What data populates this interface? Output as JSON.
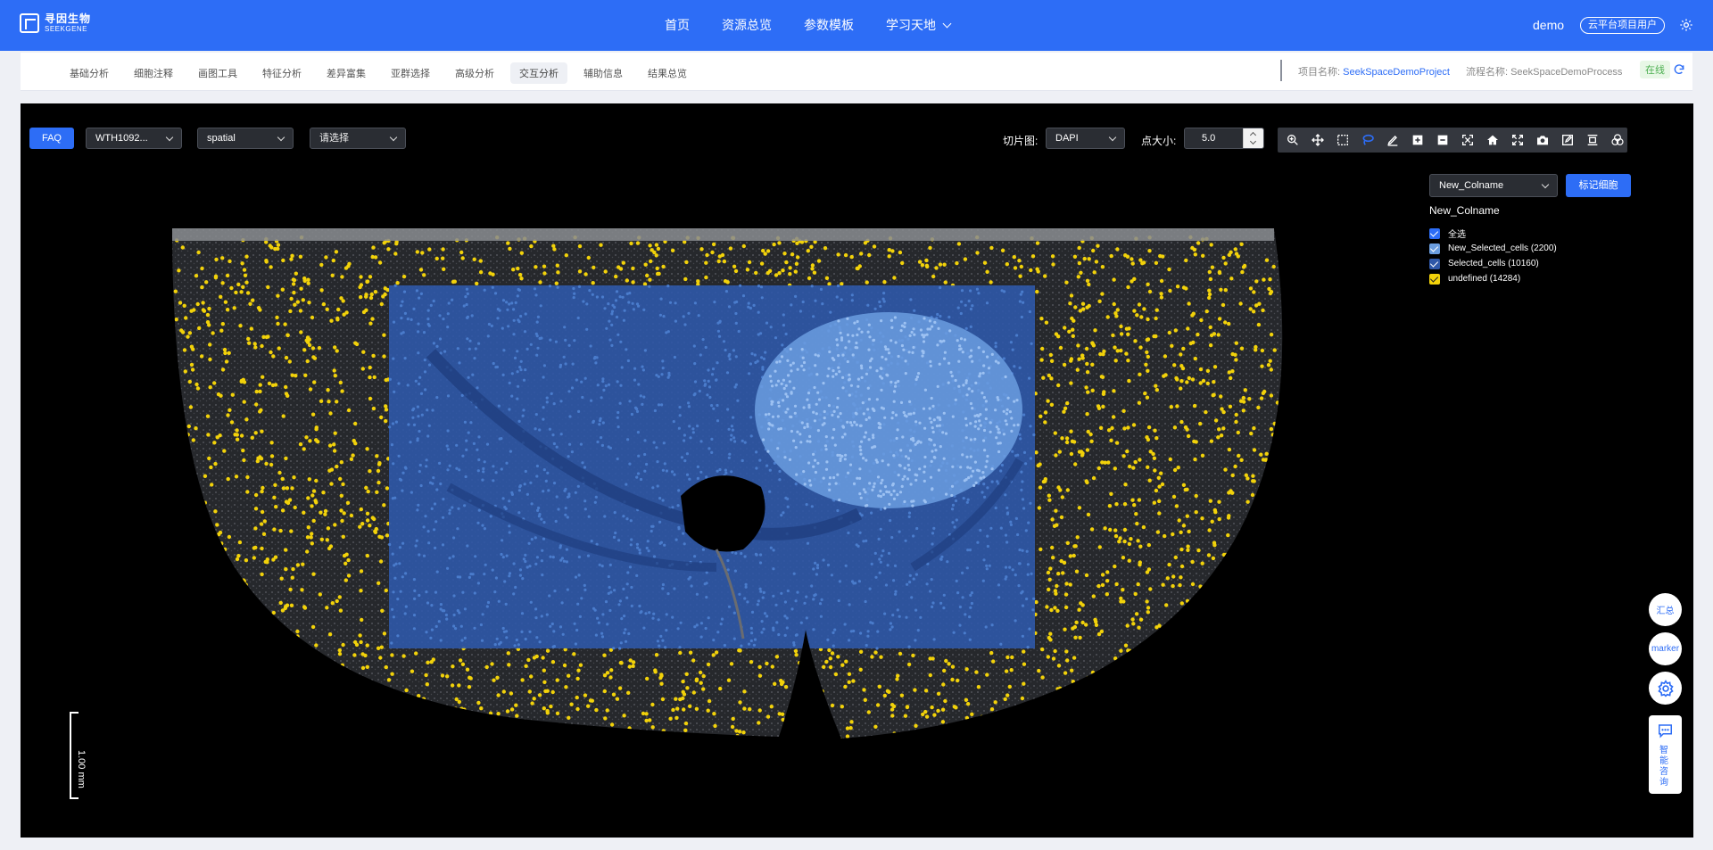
{
  "header": {
    "logo_cn": "寻因生物",
    "logo_en": "SEEKGENE",
    "nav": [
      "首页",
      "资源总览",
      "参数模板",
      "学习天地"
    ],
    "user": "demo",
    "role": "云平台项目用户"
  },
  "subnav": {
    "tabs": [
      "基础分析",
      "细胞注释",
      "画图工具",
      "特征分析",
      "差异富集",
      "亚群选择",
      "高级分析",
      "交互分析",
      "辅助信息",
      "结果总览"
    ],
    "active_index": 7,
    "project_label": "项目名称:",
    "project_value": "SeekSpaceDemoProject",
    "process_label": "流程名称:",
    "process_value": "SeekSpaceDemoProcess",
    "status": "在线"
  },
  "controls": {
    "faq": "FAQ",
    "sample": "WTH1092...",
    "embedding": "spatial",
    "select_placeholder": "请选择",
    "slice_label": "切片图:",
    "slice_value": "DAPI",
    "point_size_label": "点大小:",
    "point_size": "5.0"
  },
  "toolbar_icons": [
    "zoom-in-icon",
    "pan-icon",
    "box-select-icon",
    "lasso-icon",
    "draw-icon",
    "zoom-plus-icon",
    "zoom-minus-icon",
    "autoscale-icon",
    "home-icon",
    "fullscreen-icon",
    "camera-icon",
    "edit-icon",
    "fit-icon",
    "venn-icon"
  ],
  "legend": {
    "dropdown": "New_Colname",
    "mark_button": "标记细胞",
    "title": "New_Colname",
    "items": [
      {
        "label": "全选",
        "color": "#2d6df6"
      },
      {
        "label": "New_Selected_cells (2200)",
        "color": "#6b9ee0"
      },
      {
        "label": "Selected_cells (10160)",
        "color": "#2f58a8"
      },
      {
        "label": "undefined (14284)",
        "color": "#f2d20a"
      }
    ]
  },
  "scalebar": "1.00 mm",
  "float_buttons": {
    "summary": "汇总",
    "marker": "marker",
    "consult": "智能咨询"
  }
}
